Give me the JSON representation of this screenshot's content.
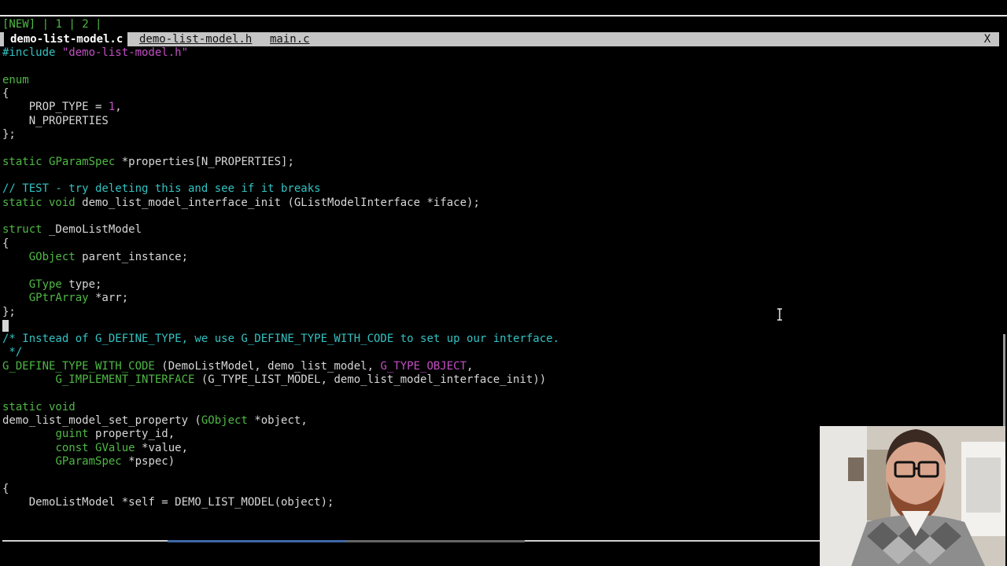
{
  "tmux_status": {
    "new_label": "[NEW]",
    "separator1": " | ",
    "win1": "1",
    "separator2": " | ",
    "win2": "2",
    "separator3": " |"
  },
  "tabs": {
    "active": "demo-list-model.c",
    "tab2": "demo-list-model.h",
    "tab3": "main.c",
    "close": "X"
  },
  "code": {
    "l1_pre": "#include ",
    "l1_str": "\"demo-list-model.h\"",
    "l2": "",
    "l3_kw": "enum",
    "l4": "{",
    "l5_a": "    PROP_TYPE = ",
    "l5_num": "1",
    "l5_b": ",",
    "l6": "    N_PROPERTIES",
    "l7": "};",
    "l8": "",
    "l9_kw": "static",
    "l9_type": "GParamSpec",
    "l9_rest": " *properties[N_PROPERTIES];",
    "l10": "",
    "l11_cmt": "// TEST - try deleting this and see if it breaks",
    "l12_kw": "static void",
    "l12_rest": " demo_list_model_interface_init (GListModelInterface *iface);",
    "l13": "",
    "l14_kw": "struct",
    "l14_rest": " _DemoListModel",
    "l15": "{",
    "l16_type": "GObject",
    "l16_rest": " parent_instance;",
    "l17": "",
    "l18_type": "GType",
    "l18_rest": " type;",
    "l19_type": "GPtrArray",
    "l19_rest": " *arr;",
    "l20": "};",
    "l21": "",
    "l22_cmt": "/* Instead of G_DEFINE_TYPE, we use G_DEFINE_TYPE_WITH_CODE to set up our interface.",
    "l23_cmt": " */",
    "l24_mac": "G_DEFINE_TYPE_WITH_CODE",
    "l24_a": " (DemoListModel, demo_list_model, ",
    "l24_str": "G_TYPE_OBJECT",
    "l24_b": ",",
    "l25_mac": "G_IMPLEMENT_INTERFACE",
    "l25_rest": " (G_TYPE_LIST_MODEL, demo_list_model_interface_init))",
    "l26": "",
    "l27_kw": "static void",
    "l28_a": "demo_list_model_set_property (",
    "l28_type": "GObject",
    "l28_b": " *object,",
    "l29_type": "guint",
    "l29_rest": " property_id,",
    "l30_kw": "const",
    "l30_type": "GValue",
    "l30_rest": " *value,",
    "l31_type": "GParamSpec",
    "l31_rest": " *pspec)",
    "l32": "",
    "l33": "{",
    "l34_rest": "    DemoListModel *self = DEMO_LIST_MODEL(object);"
  },
  "colors": {
    "keyword": "#4fb845",
    "string": "#c24fc2",
    "comment": "#33c2c2",
    "text": "#d7d7d7"
  }
}
